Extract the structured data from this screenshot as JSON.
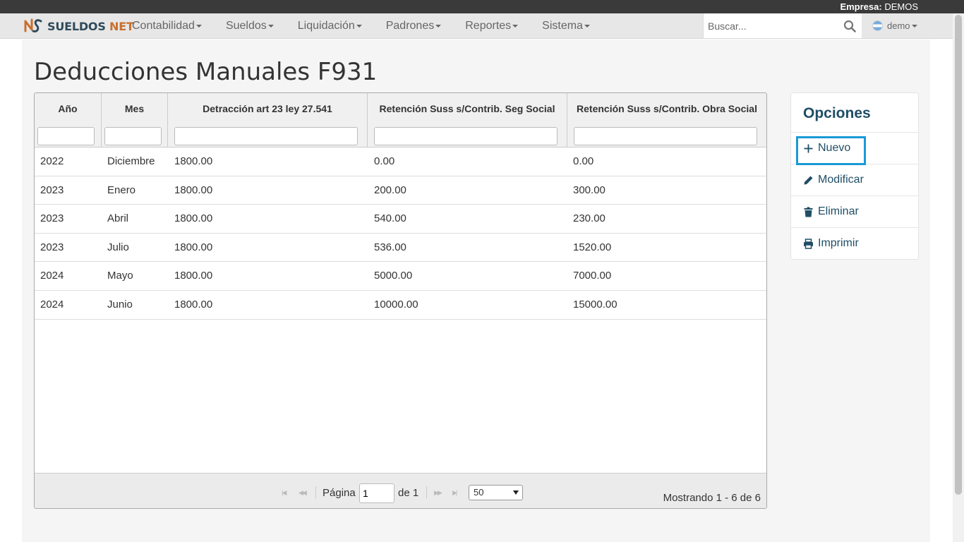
{
  "company_bar": {
    "label": "Empresa:",
    "value": "DEMOS"
  },
  "brand": {
    "part1": "SUELDOS",
    "part2": "NET"
  },
  "nav": {
    "items": [
      {
        "label": "Contabilidad"
      },
      {
        "label": "Sueldos"
      },
      {
        "label": "Liquidación"
      },
      {
        "label": "Padrones"
      },
      {
        "label": "Reportes"
      },
      {
        "label": "Sistema"
      }
    ],
    "search_placeholder": "Buscar...",
    "user": "demo"
  },
  "page_title": "Deducciones Manuales F931",
  "grid": {
    "columns": [
      "Año",
      "Mes",
      "Detracción art 23 ley 27.541",
      "Retención Suss s/Contrib. Seg Social",
      "Retención Suss s/Contrib. Obra Social"
    ],
    "rows": [
      [
        "2022",
        "Diciembre",
        "1800.00",
        "0.00",
        "0.00"
      ],
      [
        "2023",
        "Enero",
        "1800.00",
        "200.00",
        "300.00"
      ],
      [
        "2023",
        "Abril",
        "1800.00",
        "540.00",
        "230.00"
      ],
      [
        "2023",
        "Julio",
        "1800.00",
        "536.00",
        "1520.00"
      ],
      [
        "2024",
        "Mayo",
        "1800.00",
        "5000.00",
        "7000.00"
      ],
      [
        "2024",
        "Junio",
        "1800.00",
        "10000.00",
        "15000.00"
      ]
    ],
    "pager": {
      "page_label": "Página",
      "page_value": "1",
      "of_label": "de 1",
      "page_size": "50",
      "showing": "Mostrando 1 - 6 de 6"
    }
  },
  "options": {
    "title": "Opciones",
    "items": [
      {
        "label": "Nuevo",
        "icon": "plus-icon"
      },
      {
        "label": "Modificar",
        "icon": "pencil-icon"
      },
      {
        "label": "Eliminar",
        "icon": "trash-icon"
      },
      {
        "label": "Imprimir",
        "icon": "print-icon"
      }
    ]
  },
  "colors": {
    "accent": "#1f4e66",
    "highlight": "#1a9ad6",
    "brand_orange": "#c9702e"
  }
}
